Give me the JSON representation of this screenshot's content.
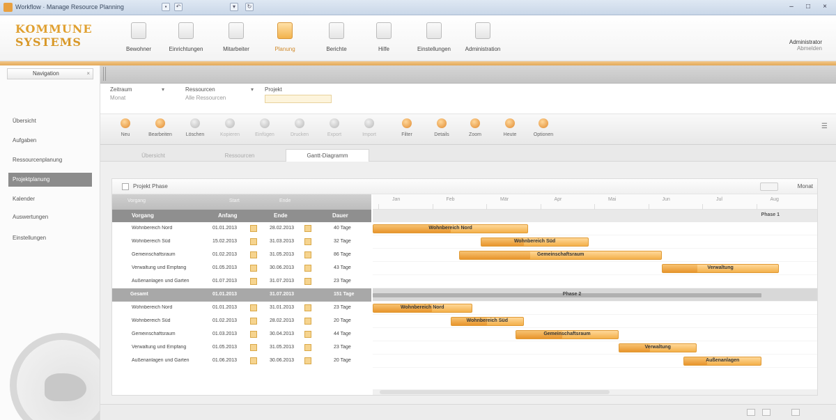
{
  "window": {
    "title": "Workflow · Manage Resource Planning"
  },
  "ribbon": {
    "logo_line1": "KOMMUNE",
    "logo_line2": "SYSTEMS",
    "buttons": [
      {
        "label": "Bewohner"
      },
      {
        "label": "Einrichtungen"
      },
      {
        "label": "Mitarbeiter"
      },
      {
        "label": "Planung"
      },
      {
        "label": "Berichte"
      },
      {
        "label": "Hilfe"
      },
      {
        "label": "Einstellungen"
      },
      {
        "label": "Administration"
      }
    ],
    "active_index": 3,
    "user_line1": "Administrator",
    "user_line2": "Abmelden"
  },
  "nav": {
    "tab_label": "Navigation",
    "items": [
      {
        "label": "Übersicht"
      },
      {
        "label": "Aufgaben"
      },
      {
        "label": "Ressourcenplanung"
      },
      {
        "label": "Projektplanung"
      },
      {
        "label": "Kalender"
      },
      {
        "label": "Auswertungen"
      },
      {
        "label": "Einstellungen"
      }
    ],
    "active_index": 3
  },
  "filters": [
    {
      "label": "Zeitraum",
      "value": "Monat"
    },
    {
      "label": "Ressourcen",
      "value": "Alle Ressourcen"
    },
    {
      "label": "Projekt",
      "value": ""
    }
  ],
  "toolbar": {
    "buttons": [
      {
        "label": "Neu"
      },
      {
        "label": "Bearbeiten"
      },
      {
        "label": "Löschen"
      },
      {
        "label": "Kopieren"
      },
      {
        "label": "Einfügen"
      },
      {
        "label": "Drucken"
      },
      {
        "label": "Export"
      },
      {
        "label": "Import"
      },
      {
        "label": "Filter"
      },
      {
        "label": "Details"
      },
      {
        "label": "Zoom"
      },
      {
        "label": "Heute"
      },
      {
        "label": "Optionen"
      }
    ]
  },
  "tabs": [
    {
      "label": "Übersicht"
    },
    {
      "label": "Ressourcen"
    },
    {
      "label": "Gantt-Diagramm"
    }
  ],
  "tabs_active_index": 2,
  "panel": {
    "title": "Projekt Phase",
    "scale_label": "Monat"
  },
  "grid": {
    "top_labels": [
      "Vorgang",
      "Start",
      "Ende"
    ],
    "columns": [
      "Vorgang",
      "Anfang",
      "Ende",
      "Dauer"
    ],
    "rows": [
      {
        "name": "Wohnbereich Nord",
        "start": "01.01.2013",
        "end": "28.02.2013",
        "dur": "40 Tage",
        "group": false
      },
      {
        "name": "Wohnbereich Süd",
        "start": "15.02.2013",
        "end": "31.03.2013",
        "dur": "32 Tage",
        "group": false
      },
      {
        "name": "Gemeinschaftsraum",
        "start": "01.02.2013",
        "end": "31.05.2013",
        "dur": "86 Tage",
        "group": false
      },
      {
        "name": "Verwaltung und Empfang",
        "start": "01.05.2013",
        "end": "30.06.2013",
        "dur": "43 Tage",
        "group": false
      },
      {
        "name": "Außenanlagen und Garten",
        "start": "01.07.2013",
        "end": "31.07.2013",
        "dur": "23 Tage",
        "group": false
      },
      {
        "name": "Gesamt",
        "start": "01.01.2013",
        "end": "31.07.2013",
        "dur": "151 Tage",
        "group": true
      },
      {
        "name": "Wohnbereich Nord",
        "start": "01.01.2013",
        "end": "31.01.2013",
        "dur": "23 Tage",
        "group": false
      },
      {
        "name": "Wohnbereich Süd",
        "start": "01.02.2013",
        "end": "28.02.2013",
        "dur": "20 Tage",
        "group": false
      },
      {
        "name": "Gemeinschaftsraum",
        "start": "01.03.2013",
        "end": "30.04.2013",
        "dur": "44 Tage",
        "group": false
      },
      {
        "name": "Verwaltung und Empfang",
        "start": "01.05.2013",
        "end": "31.05.2013",
        "dur": "23 Tage",
        "group": false
      },
      {
        "name": "Außenanlagen und Garten",
        "start": "01.06.2013",
        "end": "30.06.2013",
        "dur": "20 Tage",
        "group": false
      }
    ]
  },
  "gantt": {
    "scale_ticks": [
      "Jan",
      "Feb",
      "Mär",
      "Apr",
      "Mai",
      "Jun",
      "Jul",
      "Aug"
    ],
    "strip_label": "Phase 1",
    "group_label": "Phase 2",
    "bars": [
      {
        "row": 0,
        "start": 0.0,
        "end": 0.36,
        "progress": 0.5,
        "label": "Wohnbereich Nord"
      },
      {
        "row": 1,
        "start": 0.25,
        "end": 0.5,
        "progress": 0.4,
        "label": "Wohnbereich Süd"
      },
      {
        "row": 2,
        "start": 0.2,
        "end": 0.67,
        "progress": 0.35,
        "label": "Gemeinschaftsraum"
      },
      {
        "row": 3,
        "start": 0.67,
        "end": 0.94,
        "progress": 0.3,
        "label": "Verwaltung"
      },
      {
        "row": 6,
        "start": 0.0,
        "end": 0.23,
        "progress": 0.6,
        "label": "Wohnbereich Nord"
      },
      {
        "row": 7,
        "start": 0.18,
        "end": 0.35,
        "progress": 0.5,
        "label": "Wohnbereich Süd"
      },
      {
        "row": 8,
        "start": 0.33,
        "end": 0.57,
        "progress": 0.45,
        "label": "Gemeinschaftsraum"
      },
      {
        "row": 9,
        "start": 0.57,
        "end": 0.75,
        "progress": 0.4,
        "label": "Verwaltung"
      },
      {
        "row": 10,
        "start": 0.72,
        "end": 0.9,
        "progress": 0.3,
        "label": "Außenanlagen"
      }
    ],
    "summary": {
      "row": 5,
      "start": 0.0,
      "end": 0.9
    }
  },
  "colors": {
    "accent": "#f4b04a",
    "accent_dark": "#e09a35",
    "header_gray": "#8f8f8f"
  }
}
